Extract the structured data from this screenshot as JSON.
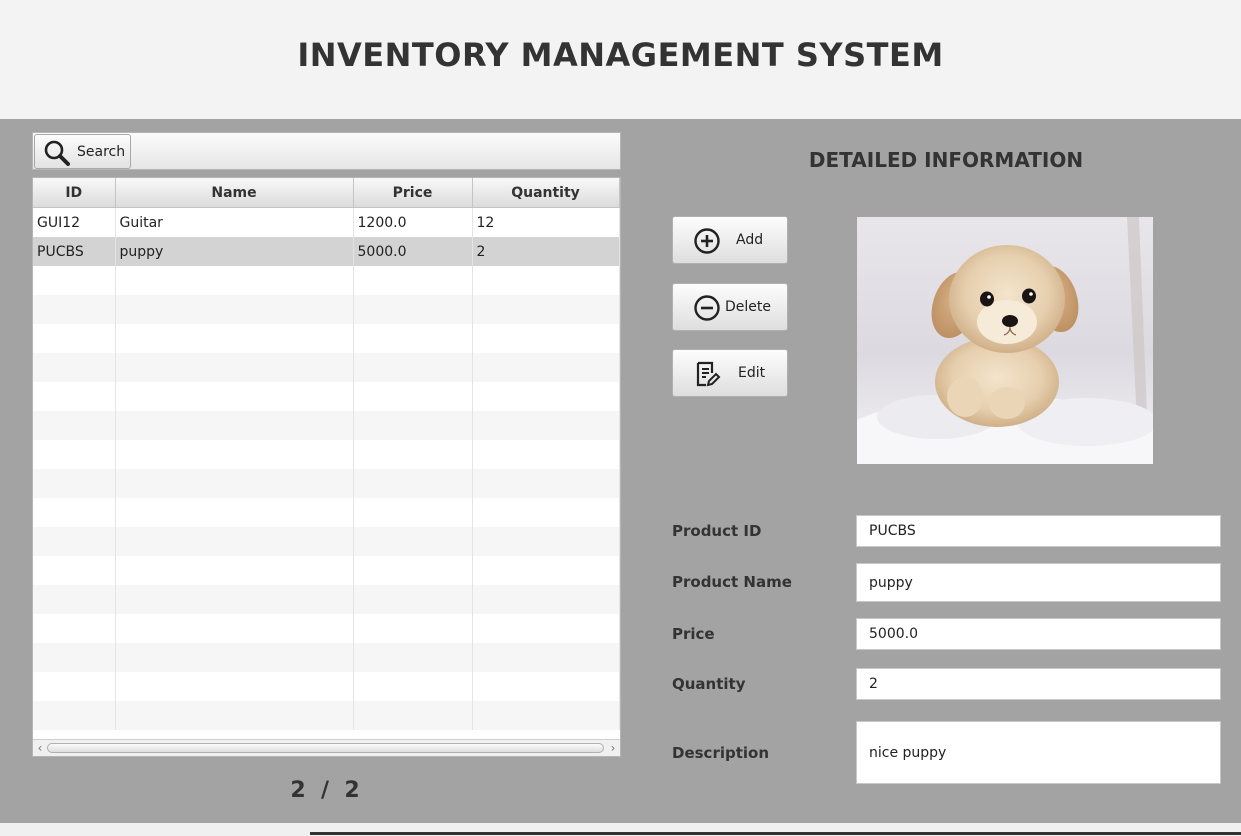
{
  "header": {
    "title": "INVENTORY MANAGEMENT SYSTEM"
  },
  "toolbar": {
    "search_label": "Search"
  },
  "table": {
    "columns": [
      "ID",
      "Name",
      "Price",
      "Quantity"
    ],
    "rows": [
      [
        "GUI12",
        "Guitar",
        "1200.0",
        "12"
      ],
      [
        "PUCBS",
        "puppy",
        "5000.0",
        "2"
      ]
    ],
    "selected_row": 1
  },
  "pager": {
    "text": "2  /  2"
  },
  "details": {
    "title": "DETAILED INFORMATION",
    "fields": {
      "product_id": {
        "label": "Product ID",
        "value": "PUCBS"
      },
      "product_name": {
        "label": "Product Name",
        "value": "puppy"
      },
      "price": {
        "label": "Price",
        "value": "5000.0"
      },
      "quantity": {
        "label": "Quantity",
        "value": "2"
      },
      "description": {
        "label": "Description",
        "value": "nice puppy"
      }
    }
  },
  "actions": {
    "add_label": "Add",
    "delete_label": "Delete",
    "edit_label": "Edit"
  },
  "icons": {
    "search": "search-icon",
    "add": "plus-circle-icon",
    "delete": "minus-circle-icon",
    "edit": "edit-document-icon"
  },
  "colors": {
    "background": "#a3a3a3",
    "header": "#f3f3f3",
    "selected_row": "#d3d3d3"
  }
}
